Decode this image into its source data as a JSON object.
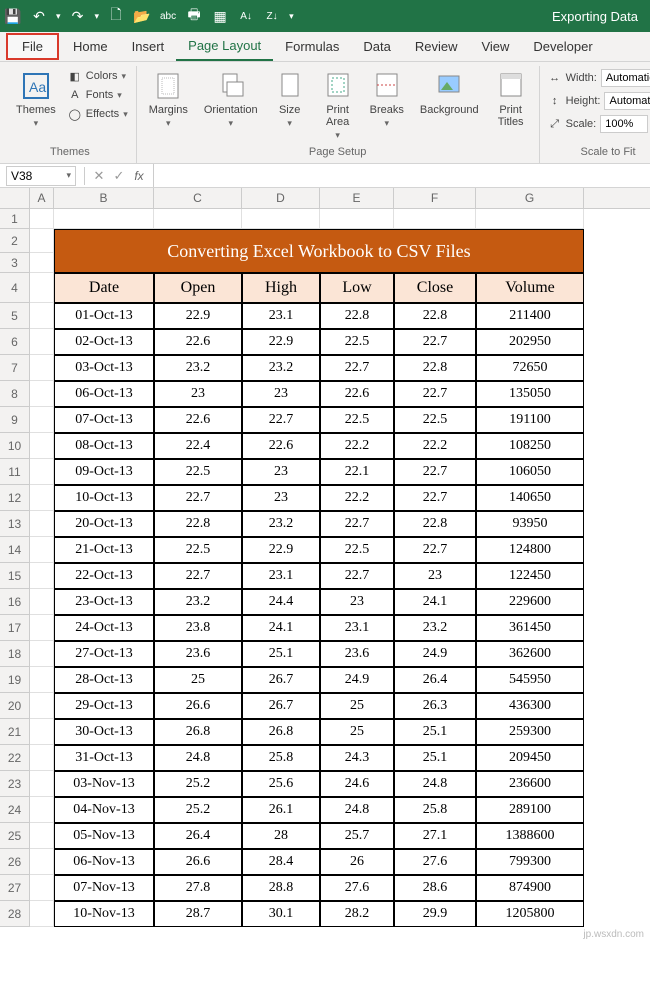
{
  "titlebar": {
    "title": "Exporting Data"
  },
  "tabs": [
    "File",
    "Home",
    "Insert",
    "Page Layout",
    "Formulas",
    "Data",
    "Review",
    "View",
    "Developer"
  ],
  "active_tab": "Page Layout",
  "ribbon": {
    "themes": {
      "label": "Themes",
      "main": "Themes",
      "colors": "Colors",
      "fonts": "Fonts",
      "effects": "Effects"
    },
    "page_setup": {
      "label": "Page Setup",
      "margins": "Margins",
      "orientation": "Orientation",
      "size": "Size",
      "print_area": "Print\nArea",
      "breaks": "Breaks",
      "background": "Background",
      "print_titles": "Print\nTitles"
    },
    "scale": {
      "label": "Scale to Fit",
      "width": "Width:",
      "height": "Height:",
      "scale": "Scale:",
      "width_val": "Automatic",
      "height_val": "Automatic",
      "scale_val": "100%"
    }
  },
  "namebox": "V38",
  "columns": [
    "A",
    "B",
    "C",
    "D",
    "E",
    "F",
    "G"
  ],
  "sheet_title": "Converting Excel Workbook to CSV Files",
  "table": {
    "headers": [
      "Date",
      "Open",
      "High",
      "Low",
      "Close",
      "Volume"
    ],
    "rows": [
      [
        "01-Oct-13",
        "22.9",
        "23.1",
        "22.8",
        "22.8",
        "211400"
      ],
      [
        "02-Oct-13",
        "22.6",
        "22.9",
        "22.5",
        "22.7",
        "202950"
      ],
      [
        "03-Oct-13",
        "23.2",
        "23.2",
        "22.7",
        "22.8",
        "72650"
      ],
      [
        "06-Oct-13",
        "23",
        "23",
        "22.6",
        "22.7",
        "135050"
      ],
      [
        "07-Oct-13",
        "22.6",
        "22.7",
        "22.5",
        "22.5",
        "191100"
      ],
      [
        "08-Oct-13",
        "22.4",
        "22.6",
        "22.2",
        "22.2",
        "108250"
      ],
      [
        "09-Oct-13",
        "22.5",
        "23",
        "22.1",
        "22.7",
        "106050"
      ],
      [
        "10-Oct-13",
        "22.7",
        "23",
        "22.2",
        "22.7",
        "140650"
      ],
      [
        "20-Oct-13",
        "22.8",
        "23.2",
        "22.7",
        "22.8",
        "93950"
      ],
      [
        "21-Oct-13",
        "22.5",
        "22.9",
        "22.5",
        "22.7",
        "124800"
      ],
      [
        "22-Oct-13",
        "22.7",
        "23.1",
        "22.7",
        "23",
        "122450"
      ],
      [
        "23-Oct-13",
        "23.2",
        "24.4",
        "23",
        "24.1",
        "229600"
      ],
      [
        "24-Oct-13",
        "23.8",
        "24.1",
        "23.1",
        "23.2",
        "361450"
      ],
      [
        "27-Oct-13",
        "23.6",
        "25.1",
        "23.6",
        "24.9",
        "362600"
      ],
      [
        "28-Oct-13",
        "25",
        "26.7",
        "24.9",
        "26.4",
        "545950"
      ],
      [
        "29-Oct-13",
        "26.6",
        "26.7",
        "25",
        "26.3",
        "436300"
      ],
      [
        "30-Oct-13",
        "26.8",
        "26.8",
        "25",
        "25.1",
        "259300"
      ],
      [
        "31-Oct-13",
        "24.8",
        "25.8",
        "24.3",
        "25.1",
        "209450"
      ],
      [
        "03-Nov-13",
        "25.2",
        "25.6",
        "24.6",
        "24.8",
        "236600"
      ],
      [
        "04-Nov-13",
        "25.2",
        "26.1",
        "24.8",
        "25.8",
        "289100"
      ],
      [
        "05-Nov-13",
        "26.4",
        "28",
        "25.7",
        "27.1",
        "1388600"
      ],
      [
        "06-Nov-13",
        "26.6",
        "28.4",
        "26",
        "27.6",
        "799300"
      ],
      [
        "07-Nov-13",
        "27.8",
        "28.8",
        "27.6",
        "28.6",
        "874900"
      ],
      [
        "10-Nov-13",
        "28.7",
        "30.1",
        "28.2",
        "29.9",
        "1205800"
      ]
    ]
  },
  "row_start": 5,
  "watermark": "jp.wsxdn.com"
}
